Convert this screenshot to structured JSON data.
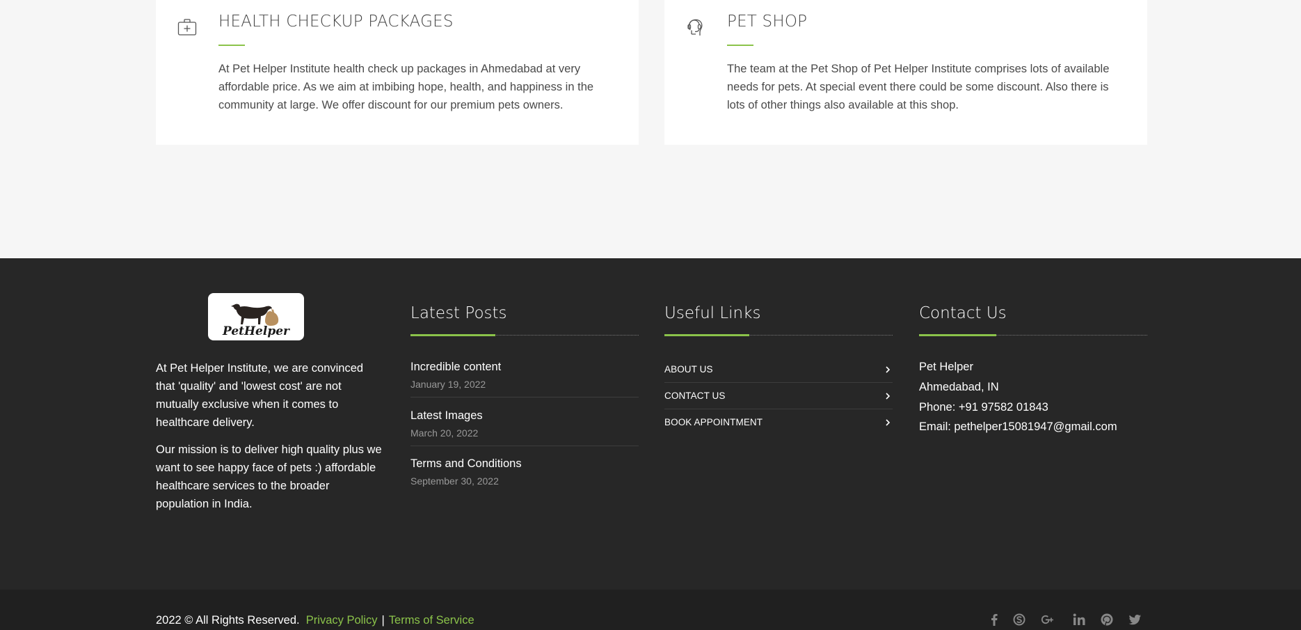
{
  "services": [
    {
      "icon": "medical-kit-icon",
      "title": "HEALTH CHECKUP PACKAGES",
      "description": "At Pet Helper Institute health check up packages in Ahmedabad at very affordable price. As we aim at imbibing hope, health, and happiness in the community at large. We offer discount for our premium pets owners."
    },
    {
      "icon": "headset-support-icon",
      "title": "PET SHOP",
      "description": "The team at the Pet Shop of Pet Helper Institute comprises lots of available needs for pets. At special event there could be some discount. Also there is lots of other things also available at this shop."
    }
  ],
  "footer": {
    "logo_text": "PetHelper",
    "about": [
      "At Pet Helper Institute, we are convinced that 'quality' and 'lowest cost' are not mutually exclusive when it comes to healthcare delivery.",
      "Our mission is to deliver high quality plus we want to see happy face of pets :) affordable healthcare services to the broader population in India."
    ],
    "latest_posts": {
      "title": "Latest Posts",
      "items": [
        {
          "title": "Incredible content",
          "date": "January 19, 2022"
        },
        {
          "title": "Latest Images",
          "date": "March 20, 2022"
        },
        {
          "title": "Terms and Conditions",
          "date": "September 30, 2022"
        }
      ]
    },
    "useful_links": {
      "title": "Useful Links",
      "items": [
        {
          "label": "ABOUT US",
          "icon": "chevron-right-icon"
        },
        {
          "label": "CONTACT US",
          "icon": "chevron-right-icon"
        },
        {
          "label": "BOOK APPOINTMENT",
          "icon": "chevron-right-icon"
        }
      ]
    },
    "contact": {
      "title": "Contact Us",
      "name": "Pet Helper",
      "city": "Ahmedabad, IN",
      "phone": "Phone: +91 97582 01843",
      "email": "Email: pethelper15081947@gmail.com"
    }
  },
  "bottom_bar": {
    "copyright": "2022 © All Rights Reserved.",
    "privacy": "Privacy Policy",
    "separator": "|",
    "terms": "Terms of Service",
    "social": [
      "facebook-icon",
      "skype-icon",
      "google-plus-icon",
      "linkedin-icon",
      "pinterest-icon",
      "twitter-icon"
    ]
  },
  "colors": {
    "accent": "#8bc34a",
    "footer_bg": "#272727",
    "page_bg": "#f6f6f6"
  }
}
